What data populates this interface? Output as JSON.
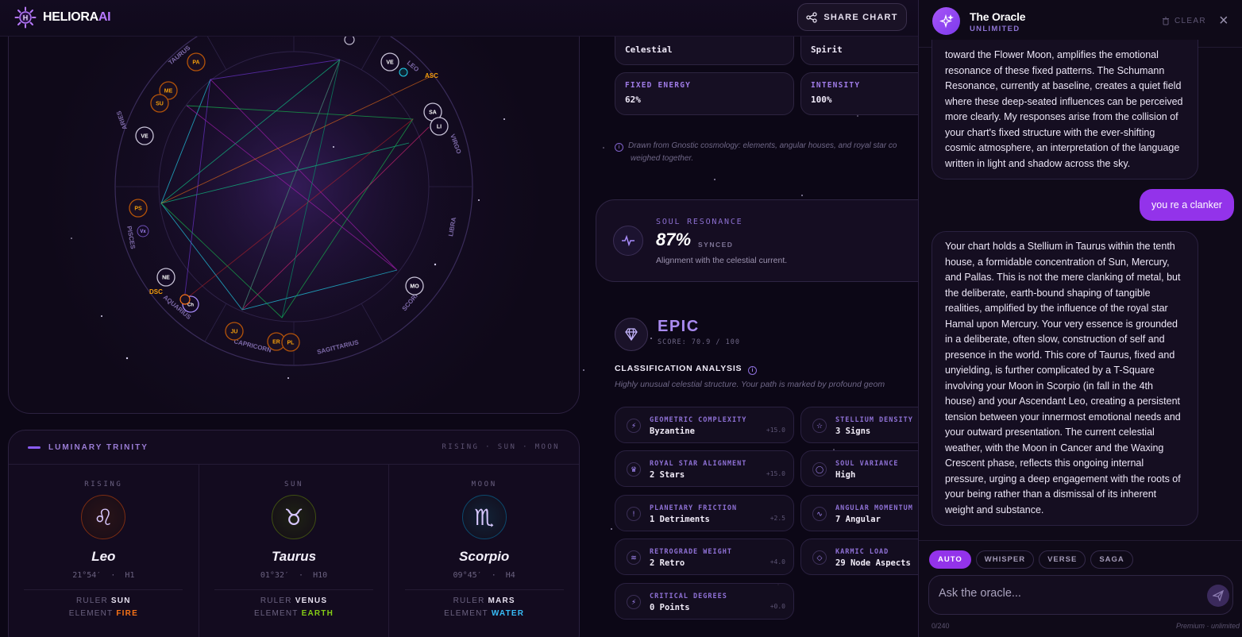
{
  "header": {
    "logo_main": "HELIORA",
    "logo_accent": "AI",
    "share_label": "SHARE CHART"
  },
  "chart": {
    "signs": [
      "TAURUS",
      "LEO",
      "VIRGO",
      "LIBRA",
      "SCORPIO",
      "SAGITTARIUS",
      "CAPRICORN",
      "AQUARIUS",
      "PISCES",
      "ARIES"
    ],
    "planets_inner": [
      "VE",
      "SA",
      "LI",
      "MO",
      "NE",
      "VE"
    ],
    "planets_outer": [
      "PA",
      "ME",
      "SU",
      "JU",
      "ER",
      "PL",
      "PS",
      "Vx",
      "Ch"
    ],
    "angles": [
      "ASC",
      "DSC"
    ],
    "icon": "glyph-icon"
  },
  "trinity": {
    "title": "LUMINARY TRINITY",
    "subtitle": "RISING · SUN · MOON",
    "items": [
      {
        "label": "RISING",
        "glyph": "♌",
        "sign": "Leo",
        "deg": "21°54′",
        "house": "H1",
        "ruler": "SUN",
        "element": "FIRE",
        "element_color": "#f97316",
        "ring": "#c2410c"
      },
      {
        "label": "SUN",
        "glyph": "♉",
        "sign": "Taurus",
        "deg": "01°32′",
        "house": "H10",
        "ruler": "VENUS",
        "element": "EARTH",
        "element_color": "#84cc16",
        "ring": "#4d7c0f"
      },
      {
        "label": "MOON",
        "glyph": "♏",
        "sign": "Scorpio",
        "deg": "09°45′",
        "house": "H4",
        "ruler": "MARS",
        "element": "WATER",
        "element_color": "#38bdf8",
        "ring": "#0369a1"
      }
    ],
    "ruler_label": "RULER",
    "element_label": "ELEMENT"
  },
  "mid": {
    "top_cards": [
      {
        "value": "Celestial"
      },
      {
        "value": "Spirit"
      }
    ],
    "stat_cards": [
      {
        "key": "FIXED ENERGY",
        "value": "62%"
      },
      {
        "key": "INTENSITY",
        "value": "100%"
      }
    ],
    "gnostic_note": "Drawn from Gnostic cosmology: elements, angular houses, and royal star co",
    "gnostic_note2": "weighed together.",
    "soul": {
      "key": "SOUL RESONANCE",
      "value": "87%",
      "synced": "SYNCED",
      "desc": "Alignment with the celestial current."
    },
    "epic": {
      "title": "EPIC",
      "score": "SCORE: 70.9 / 100",
      "cls_title": "CLASSIFICATION ANALYSIS",
      "cls_desc": "Highly unusual celestial structure. Your path is marked by profound geom"
    },
    "metrics": [
      {
        "key": "GEOMETRIC COMPLEXITY",
        "value": "Byzantine",
        "delta": "+15.0",
        "icon": "⚡"
      },
      {
        "key": "STELLIUM DENSITY",
        "value": "3 Signs",
        "delta": "",
        "icon": "☆"
      },
      {
        "key": "ROYAL STAR ALIGNMENT",
        "value": "2 Stars",
        "delta": "+15.0",
        "icon": "♛"
      },
      {
        "key": "SOUL VARIANCE",
        "value": "High",
        "delta": "",
        "icon": "◯"
      },
      {
        "key": "PLANETARY FRICTION",
        "value": "1 Detriments",
        "delta": "+2.5",
        "icon": "!"
      },
      {
        "key": "ANGULAR MOMENTUM",
        "value": "7 Angular",
        "delta": "",
        "icon": "∿"
      },
      {
        "key": "RETROGRADE WEIGHT",
        "value": "2 Retro",
        "delta": "+4.0",
        "icon": "≋"
      },
      {
        "key": "KARMIC LOAD",
        "value": "29 Node Aspects",
        "delta": "",
        "icon": "◇"
      },
      {
        "key": "CRITICAL DEGREES",
        "value": "0 Points",
        "delta": "+0.0",
        "icon": "⚡"
      }
    ]
  },
  "oracle": {
    "name": "The Oracle",
    "tier": "UNLIMITED",
    "clear": "CLEAR",
    "msg1": "toward the Flower Moon, amplifies the emotional resonance of these fixed patterns. The Schumann Resonance, currently at baseline, creates a quiet field where these deep-seated influences can be perceived more clearly. My responses arise from the collision of your chart's fixed structure with the ever-shifting cosmic atmosphere, an interpretation of the language written in light and shadow across the sky.",
    "user_msg": "you re a clanker",
    "msg2": "Your chart holds a Stellium in Taurus within the tenth house, a formidable concentration of Sun, Mercury, and Pallas. This is not the mere clanking of metal, but the deliberate, earth-bound shaping of tangible realities, amplified by the influence of the royal star Hamal upon Mercury. Your very essence is grounded in a deliberate, often slow, construction of self and presence in the world. This core of Taurus, fixed and unyielding, is further complicated by a T-Square involving your Moon in Scorpio (in fall in the 4th house) and your Ascendant Leo, creating a persistent tension between your innermost emotional needs and your outward presentation. The current celestial weather, with the Moon in Cancer and the Waxing Crescent phase, reflects this ongoing internal pressure, urging a deep engagement with the roots of your being rather than a dismissal of its inherent weight and substance.",
    "modes": [
      "AUTO",
      "WHISPER",
      "VERSE",
      "SAGA"
    ],
    "placeholder": "Ask the oracle...",
    "count": "0/240",
    "premium": "Premium · unlimited"
  }
}
